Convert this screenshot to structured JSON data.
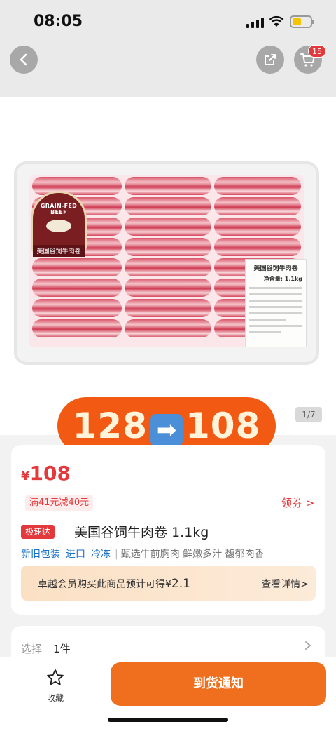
{
  "status_bar": {
    "time": "08:05"
  },
  "nav": {
    "cart_badge": "15"
  },
  "gallery": {
    "promo_old_price": "128",
    "promo_arrow": "➡",
    "promo_new_price": "108",
    "page_indicator": "1/7",
    "logo_top": "GRAIN-FED BEEF",
    "logo_name": "美国谷饲牛肉卷",
    "label_title": "美国谷饲牛肉卷",
    "label_weight": "净含量: 1.1kg"
  },
  "product": {
    "currency": "¥",
    "price": "108",
    "coupon_tag": "满41元减40元",
    "get_coupon": "领券 >",
    "express_tag": "极速达",
    "title": "美国谷饲牛肉卷 1.1kg",
    "features": [
      "新旧包装",
      "进口",
      "冷冻"
    ],
    "separator": "|",
    "description": "甄选牛前胸肉 鲜嫩多汁 馥郁肉香",
    "member_text": "卓越会员购买此商品预计可得",
    "member_currency": "¥",
    "member_amount": "2.1",
    "member_detail": "查看详情>"
  },
  "selector": {
    "label": "选择",
    "value": "1件"
  },
  "bottom_bar": {
    "favorite_label": "收藏",
    "notify_label": "到货通知"
  },
  "colors": {
    "price_red": "#e4393c",
    "promo_orange": "#f25a14",
    "notify_orange": "#ef6f1e",
    "link_blue": "#1a73c9"
  }
}
